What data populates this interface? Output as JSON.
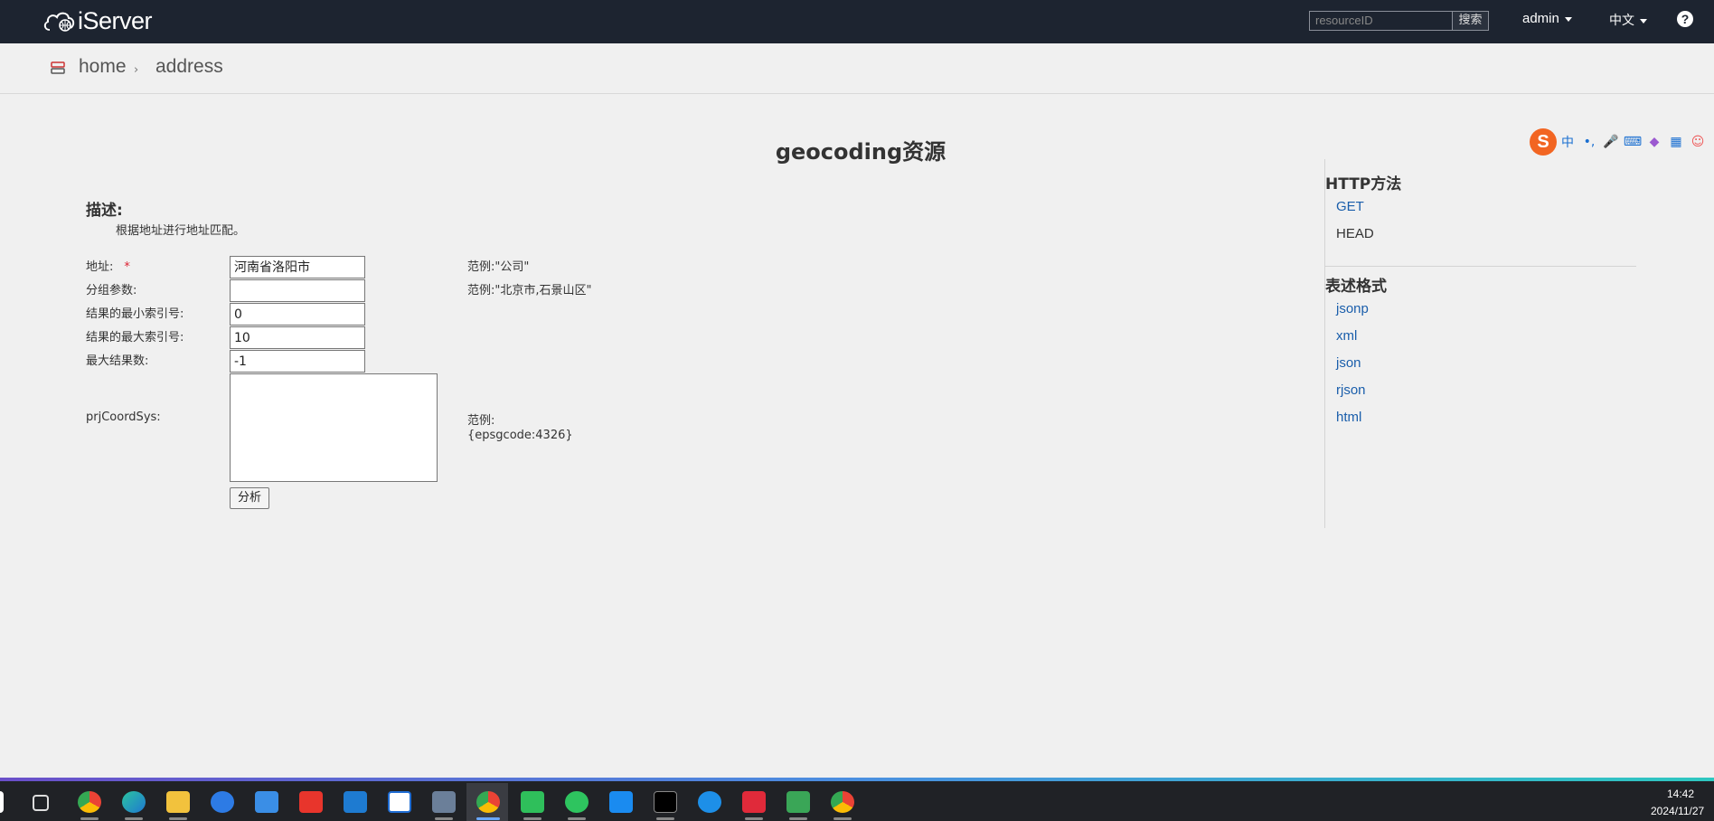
{
  "navbar": {
    "brand": "iServer",
    "search_placeholder": "resourceID",
    "search_button": "搜索",
    "user": "admin",
    "language": "中文",
    "help": "?"
  },
  "breadcrumb": {
    "home": "home",
    "separator": "›",
    "current": "address"
  },
  "page": {
    "title": "geocoding资源",
    "description_label": "描述:",
    "description_text": "根据地址进行地址匹配。"
  },
  "form": {
    "address_label": "地址:",
    "required_mark": "*",
    "address_value": "河南省洛阳市",
    "address_hint": "范例:\"公司\"",
    "group_label": "分组参数:",
    "group_value": "",
    "group_hint": "范例:\"北京市,石景山区\"",
    "min_index_label": "结果的最小索引号:",
    "min_index_value": "0",
    "max_index_label": "结果的最大索引号:",
    "max_index_value": "10",
    "max_result_label": "最大结果数:",
    "max_result_value": "-1",
    "prj_label": "prjCoordSys:",
    "prj_value": "",
    "prj_hint_1": "范例:",
    "prj_hint_2": "{epsgcode:4326}",
    "analyze_button": "分析"
  },
  "sidebar": {
    "http_heading": "HTTP方法",
    "methods": [
      "GET",
      "HEAD"
    ],
    "format_heading": "表述格式",
    "formats": [
      "jsonp",
      "xml",
      "json",
      "rjson",
      "html"
    ]
  },
  "ime": {
    "logo": "S",
    "items": [
      "中",
      "•,",
      "mic",
      "kbd",
      "skin",
      "grid",
      "face"
    ]
  },
  "taskbar": {
    "time": "14:42",
    "date": "2024/11/27",
    "apps": [
      "start-icon",
      "task-view-icon",
      "chrome-icon",
      "edge-icon",
      "file-explorer-icon",
      "browser-icon",
      "feishu-icon",
      "wps-icon",
      "vscode-icon",
      "app-d-icon",
      "remote-desktop-icon",
      "chrome-icon",
      "app-green-icon",
      "wechat-icon",
      "app-blue-icon",
      "terminal-icon",
      "app-circle-icon",
      "app-red-icon",
      "vpn-icon",
      "chrome-icon"
    ]
  }
}
